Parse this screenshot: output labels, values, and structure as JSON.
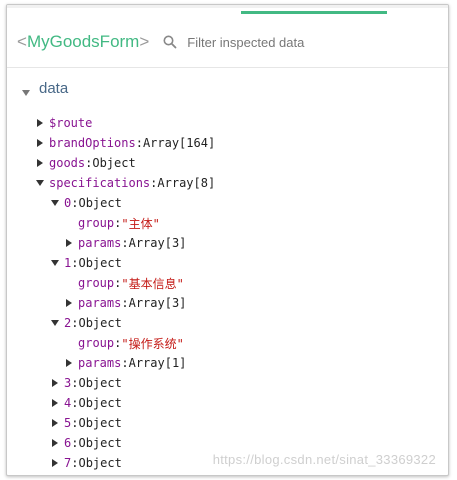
{
  "header": {
    "component_open": "<",
    "component_name": "MyGoodsForm",
    "component_close": ">",
    "search_placeholder": "Filter inspected data"
  },
  "tree": {
    "section_label": "data",
    "rows": [
      {
        "key": "$route",
        "sep": "",
        "value": "",
        "type": "plain"
      },
      {
        "key": "brandOptions",
        "sep": ": ",
        "value": "Array[164]",
        "type": "plain"
      },
      {
        "key": "goods",
        "sep": ": ",
        "value": "Object",
        "type": "plain"
      },
      {
        "key": "specifications",
        "sep": ": ",
        "value": "Array[8]",
        "type": "plain"
      },
      {
        "key": "0",
        "sep": ": ",
        "value": "Object",
        "type": "plain"
      },
      {
        "key": "group",
        "sep": ": ",
        "value": "\"主体\"",
        "type": "string"
      },
      {
        "key": "params",
        "sep": ": ",
        "value": "Array[3]",
        "type": "plain"
      },
      {
        "key": "1",
        "sep": ": ",
        "value": "Object",
        "type": "plain"
      },
      {
        "key": "group",
        "sep": ": ",
        "value": "\"基本信息\"",
        "type": "string"
      },
      {
        "key": "params",
        "sep": ": ",
        "value": "Array[3]",
        "type": "plain"
      },
      {
        "key": "2",
        "sep": ": ",
        "value": "Object",
        "type": "plain"
      },
      {
        "key": "group",
        "sep": ": ",
        "value": "\"操作系统\"",
        "type": "string"
      },
      {
        "key": "params",
        "sep": ": ",
        "value": "Array[1]",
        "type": "plain"
      },
      {
        "key": "3",
        "sep": ": ",
        "value": "Object",
        "type": "plain"
      },
      {
        "key": "4",
        "sep": ": ",
        "value": "Object",
        "type": "plain"
      },
      {
        "key": "5",
        "sep": ": ",
        "value": "Object",
        "type": "plain"
      },
      {
        "key": "6",
        "sep": ": ",
        "value": "Object",
        "type": "plain"
      },
      {
        "key": "7",
        "sep": ": ",
        "value": "Object",
        "type": "plain"
      }
    ]
  },
  "watermark": "https://blog.csdn.net/sinat_33369322",
  "colors": {
    "accent": "#42b983",
    "key": "#881391",
    "string": "#c41a16",
    "section": "#486887"
  }
}
